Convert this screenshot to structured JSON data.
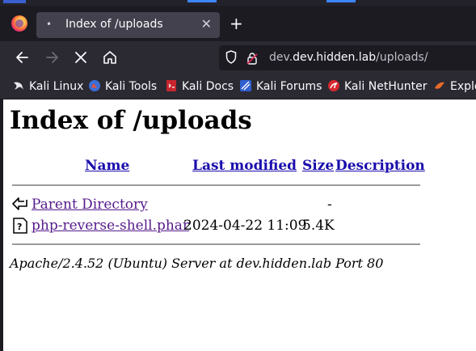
{
  "colors": {
    "browser_bg": "#1c1b22",
    "toolbar_bg": "#2b2a33",
    "tab_bg": "#42414d",
    "link_visited": "#551a8b",
    "link": "#1a0dab"
  },
  "tab": {
    "title": "Index of /uploads",
    "favicon": "loading-dot-icon"
  },
  "urlbar": {
    "host": "dev.hidden.lab",
    "path": "/uploads/"
  },
  "bookmarks": [
    {
      "label": "Kali Linux",
      "icon": "kali-dragon-icon"
    },
    {
      "label": "Kali Tools",
      "icon": "kali-tools-icon"
    },
    {
      "label": "Kali Docs",
      "icon": "kali-docs-icon"
    },
    {
      "label": "Kali Forums",
      "icon": "kali-forums-icon"
    },
    {
      "label": "Kali NetHunter",
      "icon": "kali-nethunter-icon"
    },
    {
      "label": "Explo",
      "icon": "exploit-db-icon"
    }
  ],
  "page": {
    "heading": "Index of /uploads",
    "columns": {
      "name": "Name",
      "last_modified": "Last modified",
      "size": "Size",
      "description": "Description"
    },
    "rows": [
      {
        "name": "Parent Directory",
        "modified": "",
        "size": "-",
        "description": "",
        "icon": "back-arrow-icon"
      },
      {
        "name": "php-reverse-shell.phar",
        "modified": "2024-04-22 11:09",
        "size": "5.4K",
        "description": "",
        "icon": "unknown-file-icon"
      }
    ],
    "address": "Apache/2.4.52 (Ubuntu) Server at dev.hidden.lab Port 80"
  }
}
